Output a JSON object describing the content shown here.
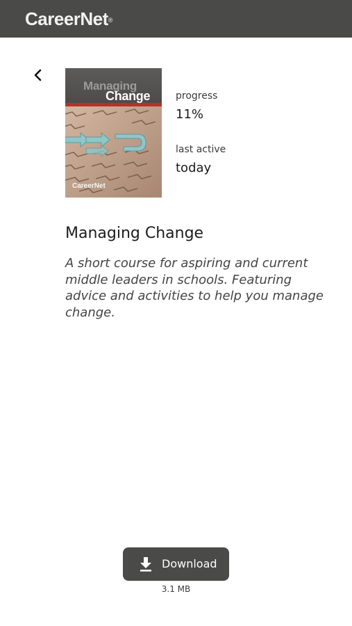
{
  "header": {
    "logo_text": "CareerNet",
    "logo_mark": "®",
    "background": "#4a4a49"
  },
  "navigation": {
    "back_icon": "chevron-left-icon"
  },
  "course": {
    "cover": {
      "line1": "Managing",
      "line2": "Change",
      "brand": "CareerNet"
    },
    "progress_label": "progress",
    "progress_value": "11%",
    "last_active_label": "last active",
    "last_active_value": "today",
    "title": "Managing Change",
    "description": "A short course for aspiring and current middle leaders in schools. Featuring advice and activities to help you manage change."
  },
  "download": {
    "label": "Download",
    "icon": "download-icon",
    "size": "3.1 MB",
    "button_color": "#4a4a49"
  }
}
